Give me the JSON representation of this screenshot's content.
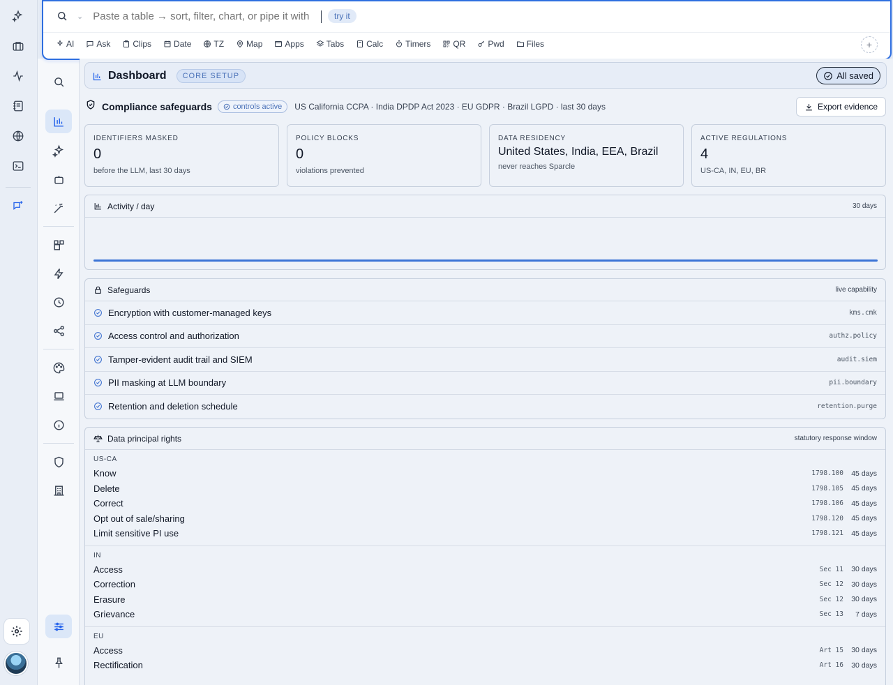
{
  "command_bar": {
    "placeholder": "Paste a table → sort, filter, chart, or pipe it with",
    "try_label": "try it",
    "tools": [
      "AI",
      "Ask",
      "Clips",
      "Date",
      "TZ",
      "Map",
      "Apps",
      "Tabs",
      "Calc",
      "Timers",
      "QR",
      "Pwd",
      "Files"
    ],
    "add_label": "+"
  },
  "dashboard": {
    "title": "Dashboard",
    "badge": "CORE SETUP",
    "saved_label": "All saved"
  },
  "compliance": {
    "title": "Compliance safeguards",
    "status_pill": "controls active",
    "regulations_line": "US California CCPA · India DPDP Act 2023 · EU GDPR · Brazil LGPD · last 30 days",
    "export_label": "Export evidence"
  },
  "cards": [
    {
      "label": "IDENTIFIERS MASKED",
      "value": "0",
      "sub": "before the LLM, last 30 days"
    },
    {
      "label": "POLICY BLOCKS",
      "value": "0",
      "sub": "violations prevented"
    },
    {
      "label": "DATA RESIDENCY",
      "value": "United States, India, EEA, Brazil",
      "sub": "never reaches Sparcle"
    },
    {
      "label": "ACTIVE REGULATIONS",
      "value": "4",
      "sub": "US-CA, IN, EU, BR"
    }
  ],
  "activity": {
    "title": "Activity / day",
    "range": "30 days"
  },
  "safeguards": {
    "title": "Safeguards",
    "right": "live capability",
    "items": [
      {
        "label": "Encryption with customer-managed keys",
        "code": "kms.cmk"
      },
      {
        "label": "Access control and authorization",
        "code": "authz.policy"
      },
      {
        "label": "Tamper-evident audit trail and SIEM",
        "code": "audit.siem"
      },
      {
        "label": "PII masking at LLM boundary",
        "code": "pii.boundary"
      },
      {
        "label": "Retention and deletion schedule",
        "code": "retention.purge"
      }
    ]
  },
  "rights": {
    "title": "Data principal rights",
    "right": "statutory response window",
    "groups": [
      {
        "name": "US-CA",
        "rows": [
          {
            "label": "Know",
            "code": "1798.100",
            "days": "45 days"
          },
          {
            "label": "Delete",
            "code": "1798.105",
            "days": "45 days"
          },
          {
            "label": "Correct",
            "code": "1798.106",
            "days": "45 days"
          },
          {
            "label": "Opt out of sale/sharing",
            "code": "1798.120",
            "days": "45 days"
          },
          {
            "label": "Limit sensitive PI use",
            "code": "1798.121",
            "days": "45 days"
          }
        ]
      },
      {
        "name": "IN",
        "rows": [
          {
            "label": "Access",
            "code": "Sec 11",
            "days": "30 days"
          },
          {
            "label": "Correction",
            "code": "Sec 12",
            "days": "30 days"
          },
          {
            "label": "Erasure",
            "code": "Sec 12",
            "days": "30 days"
          },
          {
            "label": "Grievance",
            "code": "Sec 13",
            "days": "7 days"
          }
        ]
      },
      {
        "name": "EU",
        "rows": [
          {
            "label": "Access",
            "code": "Art 15",
            "days": "30 days"
          },
          {
            "label": "Rectification",
            "code": "Art 16",
            "days": "30 days"
          }
        ]
      }
    ]
  },
  "colors": {
    "accent": "#2563eb",
    "border": "#c6cfdd",
    "background": "#eef2f8"
  }
}
